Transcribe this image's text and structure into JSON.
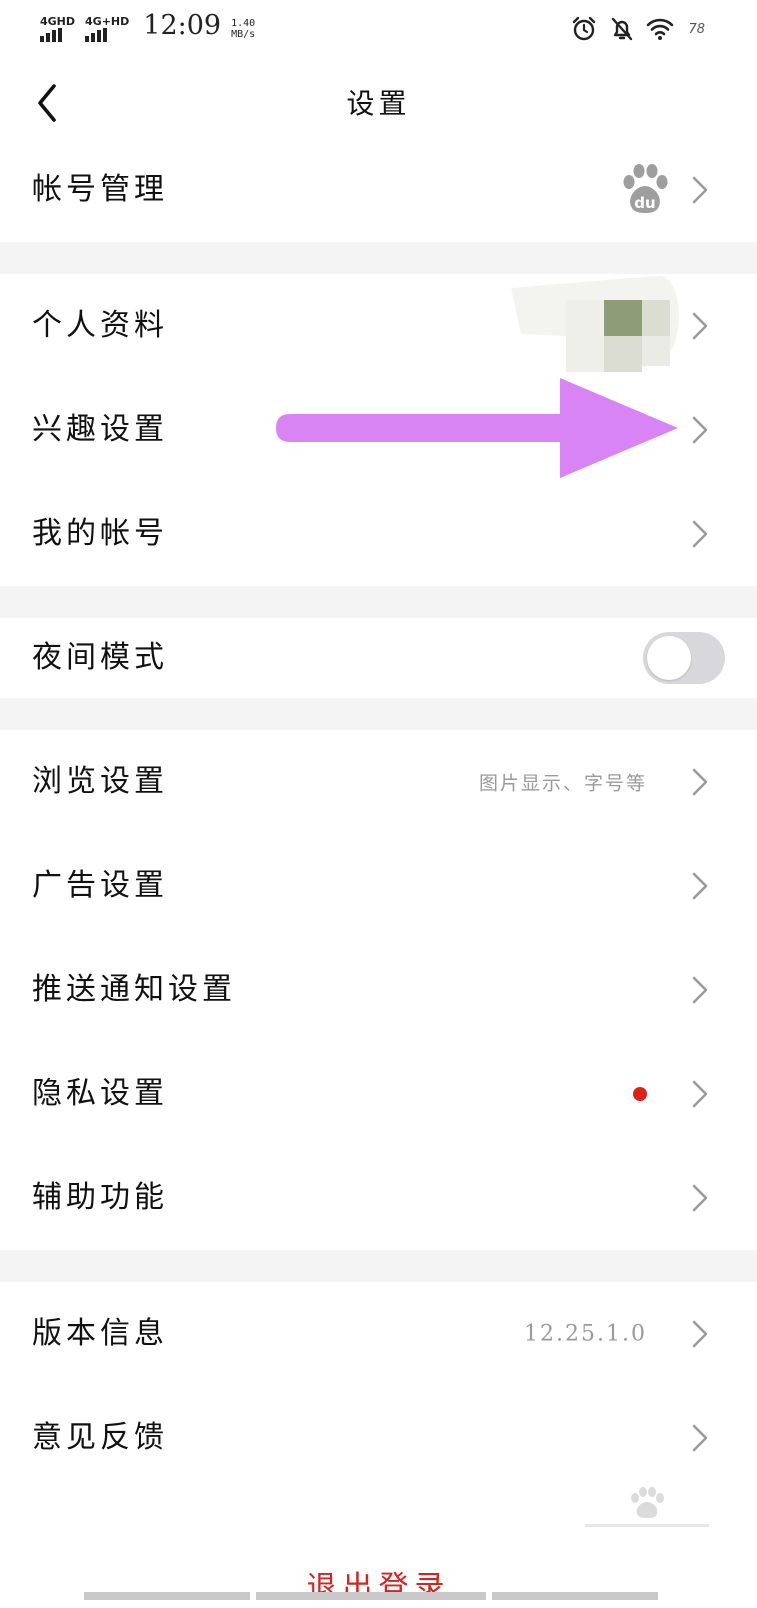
{
  "status_bar": {
    "signal_1": "4GHD",
    "signal_2": "4G+HD",
    "time": "12:09",
    "speed_value": "1.40",
    "speed_unit": "MB/s",
    "battery": "78"
  },
  "header": {
    "title": "设置",
    "back_icon": "chevron-left-icon"
  },
  "account_section": {
    "account_management": "帐号管理"
  },
  "profile_section": {
    "personal_info": "个人资料",
    "interest_settings": "兴趣设置",
    "my_account": "我的帐号"
  },
  "night_mode": {
    "label": "夜间模式",
    "enabled": false
  },
  "settings_section": {
    "browse_settings": "浏览设置",
    "browse_hint": "图片显示、字号等",
    "ad_settings": "广告设置",
    "push_settings": "推送通知设置",
    "privacy_settings": "隐私设置",
    "accessibility": "辅助功能"
  },
  "about_section": {
    "version_info": "版本信息",
    "version_number": "12.25.1.0",
    "feedback": "意见反馈"
  },
  "logout": "退出登录",
  "colors": {
    "accent_red": "#e0201b",
    "arrow_annotation": "#d884f5",
    "section_gap": "#f4f4f5",
    "toggle_off": "#d8d8dc"
  }
}
